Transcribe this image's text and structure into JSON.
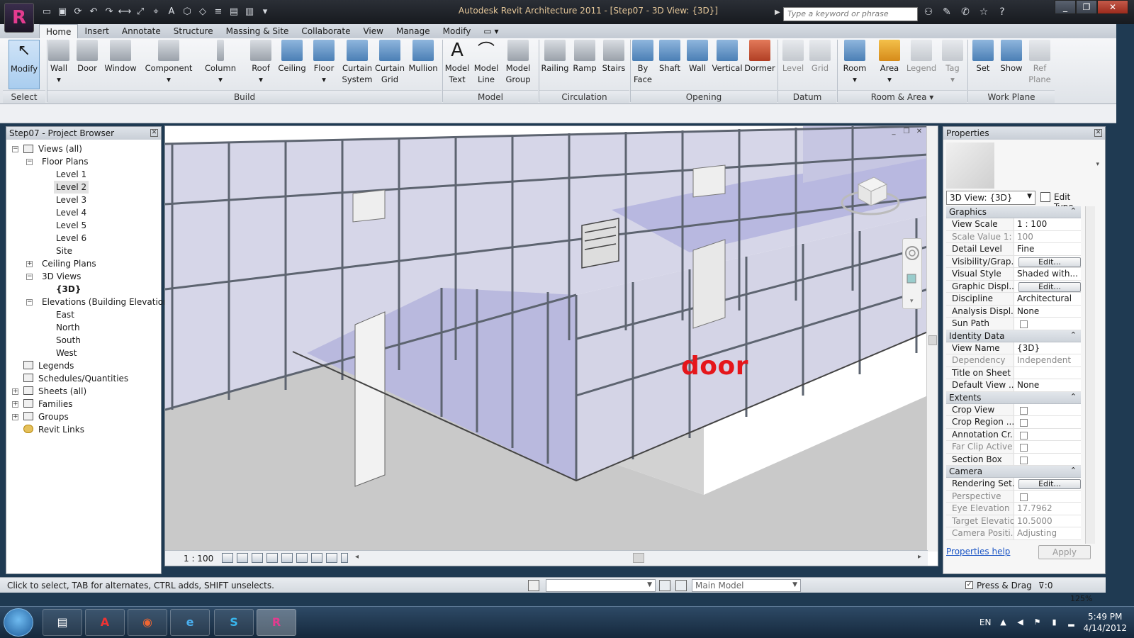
{
  "titlebar": {
    "title": "Autodesk Revit Architecture 2011 - [Step07 - 3D View: {3D}]",
    "search_placeholder": "Type a keyword or phrase"
  },
  "tabs": [
    "Home",
    "Insert",
    "Annotate",
    "Structure",
    "Massing & Site",
    "Collaborate",
    "View",
    "Manage",
    "Modify"
  ],
  "ribbon": {
    "tools": {
      "modify": "Modify",
      "wall": "Wall",
      "door": "Door",
      "window": "Window",
      "component": "Component",
      "column": "Column",
      "roof": "Roof",
      "ceiling": "Ceiling",
      "floor": "Floor",
      "curtain_system_1": "Curtain",
      "curtain_system_2": "System",
      "curtain_grid_1": "Curtain",
      "curtain_grid_2": "Grid",
      "mullion": "Mullion",
      "model_text_1": "Model",
      "model_text_2": "Text",
      "model_line_1": "Model",
      "model_line_2": "Line",
      "model_group_1": "Model",
      "model_group_2": "Group",
      "railing": "Railing",
      "ramp": "Ramp",
      "stairs": "Stairs",
      "by_face_1": "By",
      "by_face_2": "Face",
      "shaft": "Shaft",
      "wall_opening": "Wall",
      "vertical": "Vertical",
      "dormer": "Dormer",
      "level": "Level",
      "grid": "Grid",
      "room": "Room",
      "area": "Area",
      "legend": "Legend",
      "tag": "Tag",
      "set": "Set",
      "show": "Show",
      "ref_plane_1": "Ref",
      "ref_plane_2": "Plane"
    },
    "panels": {
      "select": "Select",
      "build": "Build",
      "model": "Model",
      "circulation": "Circulation",
      "opening": "Opening",
      "datum": "Datum",
      "room_area": "Room & Area ▾",
      "work_plane": "Work Plane"
    }
  },
  "browser": {
    "title": "Step07 - Project Browser",
    "views_all": "Views (all)",
    "floor_plans": "Floor Plans",
    "levels": [
      "Level 1",
      "Level 2",
      "Level 3",
      "Level 4",
      "Level 5",
      "Level 6",
      "Site"
    ],
    "ceiling_plans": "Ceiling Plans",
    "views_3d": "3D Views",
    "view_3d_item": "{3D}",
    "elevations": "Elevations (Building Elevation)",
    "elevation_items": [
      "East",
      "North",
      "South",
      "West"
    ],
    "legends": "Legends",
    "schedules": "Schedules/Quantities",
    "sheets": "Sheets (all)",
    "families": "Families",
    "groups": "Groups",
    "revit_links": "Revit Links"
  },
  "viewport": {
    "annotation": "door",
    "scale": "1 : 100"
  },
  "properties": {
    "title": "Properties",
    "type_selector": "3D View: {3D}",
    "edit_type": "Edit Type",
    "groups": {
      "graphics": "Graphics",
      "identity": "Identity Data",
      "extents": "Extents",
      "camera": "Camera"
    },
    "graphics_rows": [
      {
        "name": "View Scale",
        "value": "1 : 100"
      },
      {
        "name": "Scale Value  1:",
        "value": "100"
      },
      {
        "name": "Detail Level",
        "value": "Fine"
      },
      {
        "name": "Visibility/Grap...",
        "value": "Edit..."
      },
      {
        "name": "Visual Style",
        "value": "Shaded with..."
      },
      {
        "name": "Graphic Displ...",
        "value": "Edit..."
      },
      {
        "name": "Discipline",
        "value": "Architectural"
      },
      {
        "name": "Analysis Displ...",
        "value": "None"
      },
      {
        "name": "Sun Path",
        "value": ""
      }
    ],
    "identity_rows": [
      {
        "name": "View Name",
        "value": "{3D}"
      },
      {
        "name": "Dependency",
        "value": "Independent"
      },
      {
        "name": "Title on Sheet",
        "value": ""
      },
      {
        "name": "Default View ...",
        "value": "None"
      }
    ],
    "extents_rows": [
      {
        "name": "Crop View"
      },
      {
        "name": "Crop Region ..."
      },
      {
        "name": "Annotation Cr..."
      },
      {
        "name": "Far Clip Active"
      },
      {
        "name": "Section Box"
      }
    ],
    "camera_rows": [
      {
        "name": "Rendering Set...",
        "value": "Edit..."
      },
      {
        "name": "Perspective",
        "value": ""
      },
      {
        "name": "Eye Elevation",
        "value": "17.7962"
      },
      {
        "name": "Target Elevation",
        "value": "10.5000"
      },
      {
        "name": "Camera Positi...",
        "value": "Adjusting"
      }
    ],
    "help": "Properties help",
    "apply": "Apply"
  },
  "statusbar": {
    "hint": "Click to select, TAB for alternates, CTRL adds, SHIFT unselects.",
    "model": "Main Model",
    "press_drag": "Press & Drag",
    "filter_count": ":0",
    "zoom": "125%"
  },
  "taskbar": {
    "language": "EN",
    "time": "5:49 PM",
    "date": "4/14/2012"
  },
  "colors": {
    "door_label": "#e5161b",
    "ribbon_active": "#a9cdef",
    "title_text": "#e6c89a"
  }
}
